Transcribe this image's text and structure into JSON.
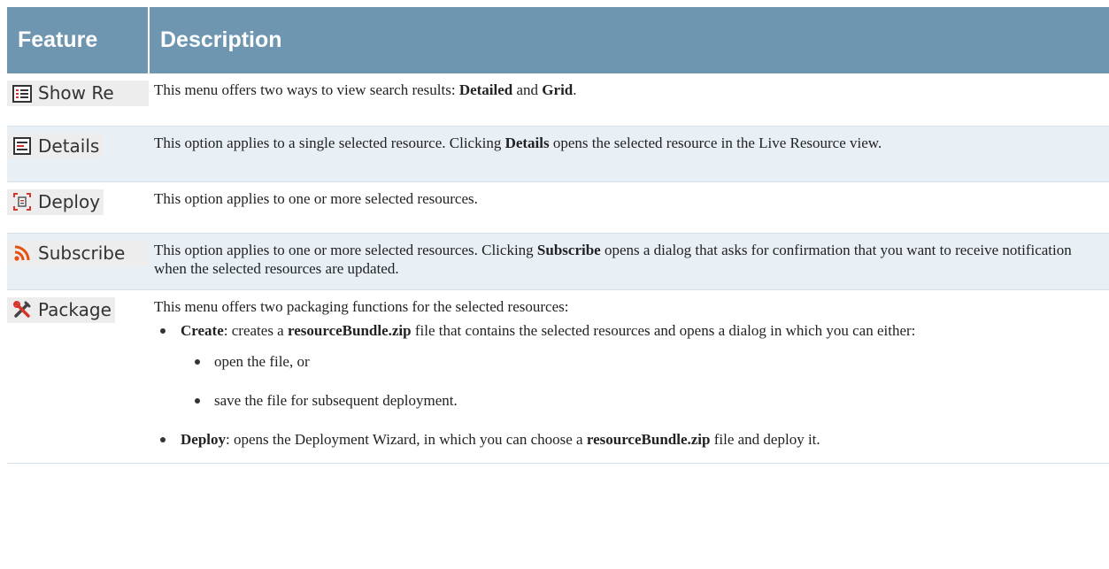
{
  "header": {
    "col_feature": "Feature",
    "col_description": "Description"
  },
  "rows": [
    {
      "button": {
        "label": "Show Re",
        "icon": "list-view-icon"
      },
      "description": {
        "t1": "This menu offers two ways to view search results: ",
        "b1": "Detailed",
        "t2": " and ",
        "b2": "Grid",
        "t3": "."
      }
    },
    {
      "button": {
        "label": "Details",
        "icon": "details-icon"
      },
      "description": {
        "t1": "This option applies to a single selected resource. Clicking ",
        "b1": "Details",
        "t2": " opens the selected resource in the Live Resource view."
      }
    },
    {
      "button": {
        "label": "Deploy",
        "icon": "deploy-icon"
      },
      "description": {
        "t1": "This option applies to one or more selected resources."
      }
    },
    {
      "button": {
        "label": "Subscribe",
        "icon": "rss-icon"
      },
      "description": {
        "t1": "This option applies to one or more selected resources. Clicking ",
        "b1": "Subscribe",
        "t2": " opens a dialog that asks for confirmation that you want to receive notification when the selected resources are updated."
      }
    },
    {
      "button": {
        "label": "Package",
        "icon": "tools-icon"
      },
      "description": {
        "intro": "This menu offers two packaging functions for the selected resources:",
        "create": {
          "b": "Create",
          "t1": ": creates a ",
          "b2": "resourceBundle.zip",
          "t2": " file that contains the selected resources and opens a dialog in which you can either:"
        },
        "sub": [
          "open the file, or",
          "save the file for subsequent deployment."
        ],
        "deploy": {
          "b": "Deploy",
          "t1": ": opens the Deployment Wizard, in which you can choose a ",
          "b2": "resourceBundle.zip",
          "t2": " file and deploy it."
        }
      }
    }
  ],
  "colors": {
    "header_bg": "#6f96b1",
    "alt_row_bg": "#e8f0f6",
    "rss": "#e8500e",
    "red_accent": "#d9342b"
  }
}
